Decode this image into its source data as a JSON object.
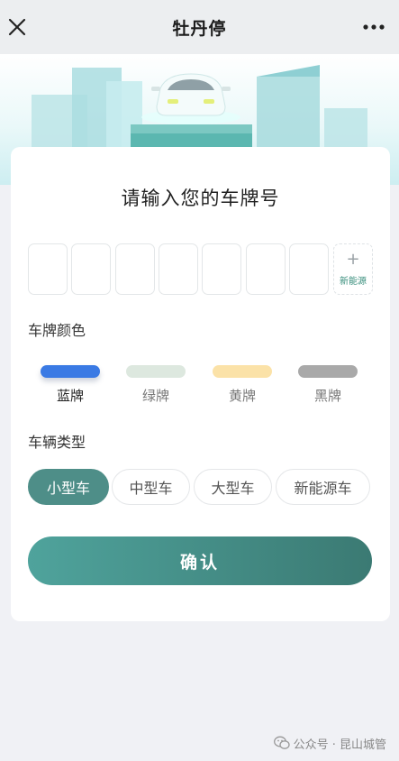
{
  "nav": {
    "title": "牡丹停",
    "close_icon": "close-icon",
    "more_icon": "more-icon"
  },
  "form": {
    "heading": "请输入您的车牌号",
    "plate_slots": [
      "",
      "",
      "",
      "",
      "",
      "",
      ""
    ],
    "new_energy_label": "新能源",
    "new_energy_plus": "+",
    "color_section_label": "车牌颜色",
    "plate_colors": [
      {
        "label": "蓝牌",
        "color": "#3a7ae4",
        "selected": true
      },
      {
        "label": "绿牌",
        "color": "#dde8df",
        "selected": false
      },
      {
        "label": "黄牌",
        "color": "#fbe2a8",
        "selected": false
      },
      {
        "label": "黑牌",
        "color": "#a9a9a9",
        "selected": false
      }
    ],
    "type_section_label": "车辆类型",
    "vehicle_types": [
      {
        "label": "小型车",
        "selected": true
      },
      {
        "label": "中型车",
        "selected": false
      },
      {
        "label": "大型车",
        "selected": false
      },
      {
        "label": "新能源车",
        "selected": false
      }
    ],
    "confirm_label": "确认"
  },
  "footer": {
    "text": "公众号 · 昆山城管",
    "icon": "wechat-icon"
  },
  "colors": {
    "accent": "#4e8e88",
    "selected_plate": "#3a7ae4"
  }
}
